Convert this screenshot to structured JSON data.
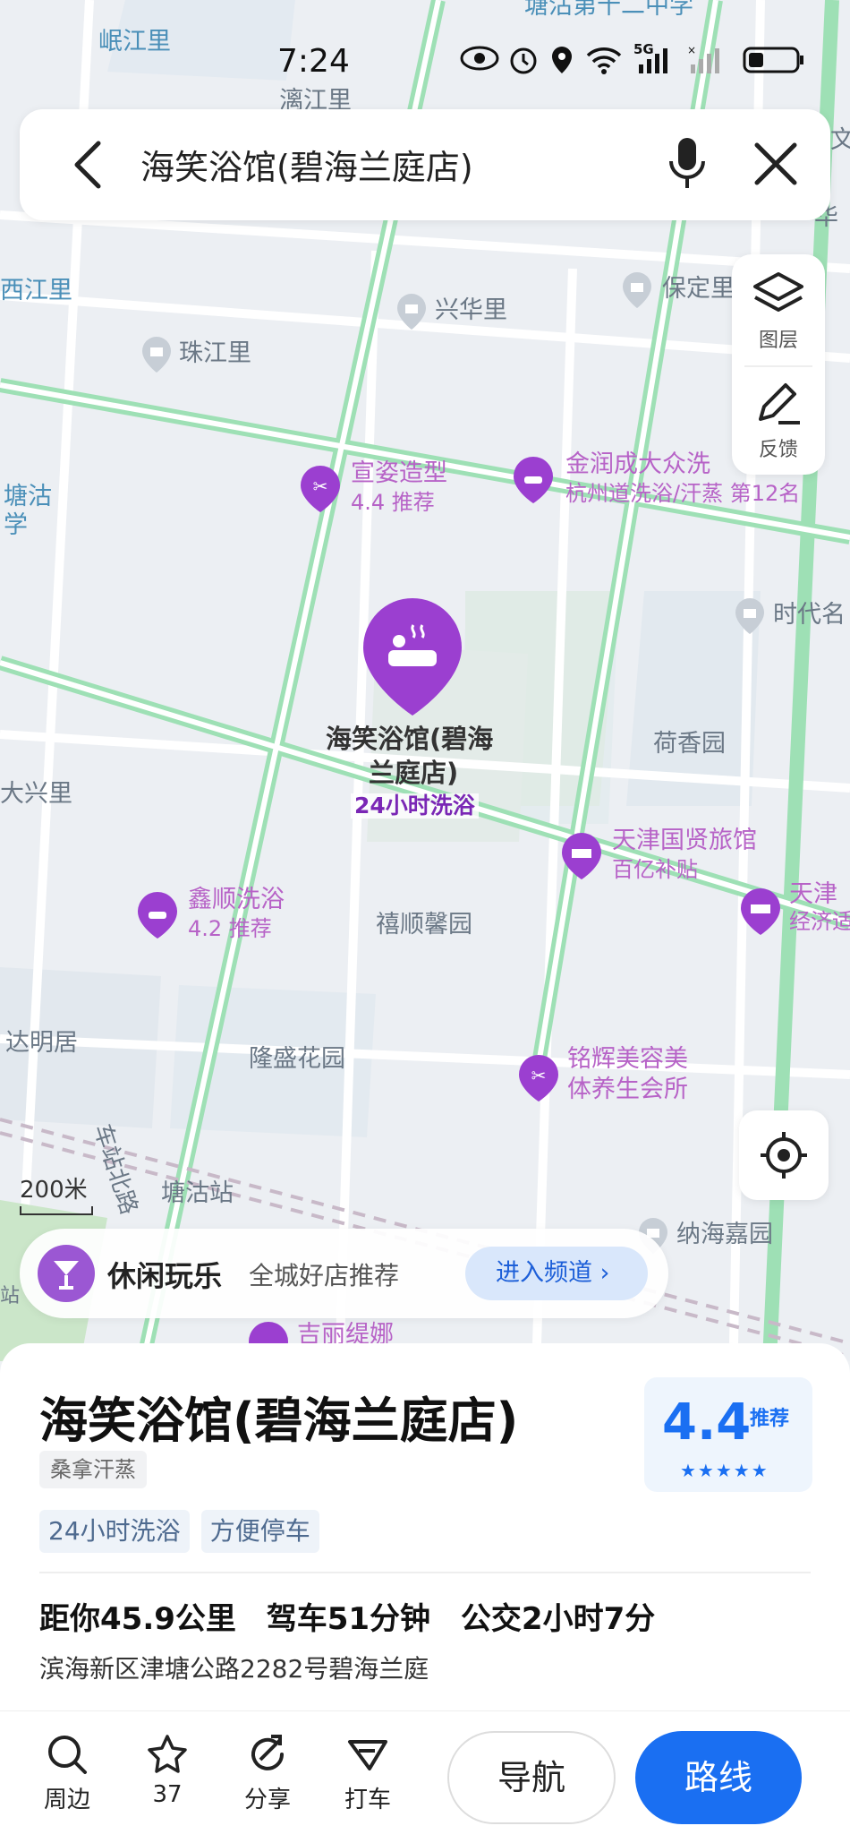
{
  "status_bar": {
    "time": "7:24",
    "network": "5G"
  },
  "search": {
    "query": "海笑浴馆(碧海兰庭店)"
  },
  "tools": {
    "layers": "图层",
    "feedback": "反馈"
  },
  "map": {
    "main_poi": {
      "name_line1": "海笑浴馆(碧海",
      "name_line2": "兰庭店)",
      "tag": "24小时洗浴"
    },
    "areas": [
      "岷江里",
      "漓江里",
      "西江里",
      "珠江里",
      "兴华里",
      "保定里",
      "时代名",
      "荷香园",
      "禧顺馨园",
      "隆盛花园",
      "达明居",
      "纳海嘉园",
      "塘沽站",
      "大兴里",
      "华",
      "文"
    ],
    "school_label": "塘沽第十二中学",
    "left_edge_label_1": "塘沽",
    "left_edge_label_2": "学",
    "street_label": "车站北路",
    "pois": [
      {
        "name": "宣姿造型",
        "sub": "4.4 推荐"
      },
      {
        "name": "金润成大众洗",
        "sub": "杭州道洗浴/汗蒸 第12名"
      },
      {
        "name": "天津国贤旅馆",
        "sub": "百亿补贴"
      },
      {
        "name": "天津",
        "sub": "经济适"
      },
      {
        "name": "鑫顺洗浴",
        "sub": "4.2 推荐"
      },
      {
        "name": "铭辉美容美",
        "sub": "体养生会所"
      },
      {
        "name": "吉丽缇娜",
        "sub": ""
      },
      {
        "name": "站",
        "sub": ""
      }
    ],
    "scale": "200米"
  },
  "channel": {
    "title": "休闲玩乐",
    "subtitle": "全城好店推荐",
    "button": "进入频道"
  },
  "place": {
    "name": "海笑浴馆(碧海兰庭店)",
    "category": "桑拿汗蒸",
    "tags": [
      "24小时洗浴",
      "方便停车"
    ],
    "distance": "距你45.9公里",
    "drive": "驾车51分钟",
    "transit": "公交2小时7分",
    "address": "滨海新区津塘公路2282号碧海兰庭",
    "rating": "4.4",
    "rating_label": "推荐",
    "stars": "★★★★★"
  },
  "actions": {
    "nearby": "周边",
    "favorites": "37",
    "share": "分享",
    "taxi": "打车",
    "navigate": "导航",
    "route": "路线"
  },
  "colors": {
    "accent": "#1a6ff2",
    "poi_purple": "#9b3fd0",
    "road_green": "#9ee0b5"
  }
}
